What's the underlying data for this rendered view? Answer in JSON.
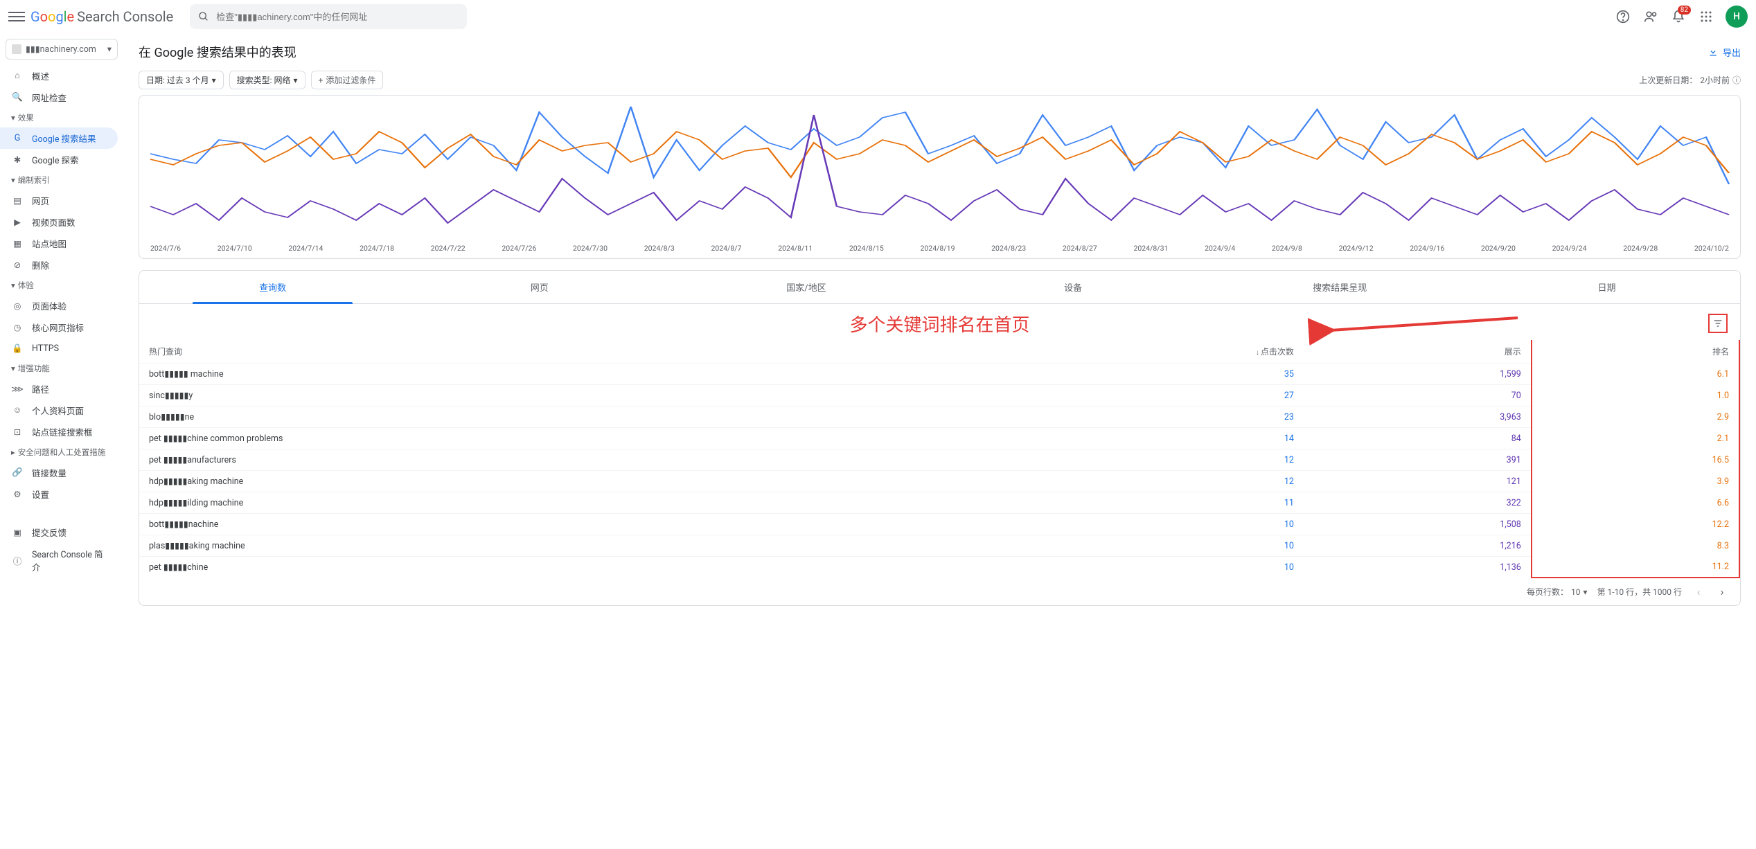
{
  "header": {
    "logo_text": "Search Console",
    "search_placeholder": "检查\"▮▮▮▮achinery.com\"中的任何网址",
    "notif_badge": "82",
    "avatar_letter": "H"
  },
  "property_name": "▮▮▮nachinery.com",
  "sidebar": {
    "overview": "概述",
    "url_inspect": "网址检查",
    "sec_performance": "效果",
    "google_search": "Google 搜索结果",
    "google_discover": "Google 探索",
    "sec_indexing": "编制索引",
    "pages": "网页",
    "video_pages": "视频页面数",
    "sitemaps": "站点地图",
    "removals": "删除",
    "sec_experience": "体验",
    "page_experience": "页面体验",
    "cwv": "核心网页指标",
    "https": "HTTPS",
    "sec_enhance": "增强功能",
    "breadcrumbs": "路径",
    "profile_pages": "个人资料页面",
    "sitelinks": "站点链接搜索框",
    "sec_security": "安全问题和人工处置措施",
    "links": "链接数量",
    "settings": "设置",
    "feedback": "提交反馈",
    "about": "Search Console 简介"
  },
  "page": {
    "title": "在 Google 搜索结果中的表现",
    "export": "导出",
    "date_chip": "日期: 过去 3 个月",
    "type_chip": "搜索类型: 网络",
    "add_filter": "添加过滤条件",
    "last_update_label": "上次更新日期：",
    "last_update_value": "2小时前"
  },
  "chart_data": {
    "type": "line",
    "x_labels": [
      "2024/7/6",
      "2024/7/10",
      "2024/7/14",
      "2024/7/18",
      "2024/7/22",
      "2024/7/26",
      "2024/7/30",
      "2024/8/3",
      "2024/8/7",
      "2024/8/11",
      "2024/8/15",
      "2024/8/19",
      "2024/8/23",
      "2024/8/27",
      "2024/8/31",
      "2024/9/4",
      "2024/9/8",
      "2024/9/12",
      "2024/9/16",
      "2024/9/20",
      "2024/9/24",
      "2024/9/28",
      "2024/10/2"
    ],
    "series": [
      {
        "name": "clicks",
        "color": "#4285f4",
        "values": [
          62,
          58,
          55,
          72,
          70,
          65,
          75,
          60,
          78,
          55,
          65,
          62,
          76,
          58,
          74,
          68,
          50,
          92,
          74,
          60,
          48,
          96,
          45,
          72,
          50,
          68,
          82,
          70,
          65,
          80,
          68,
          74,
          88,
          92,
          62,
          68,
          75,
          55,
          62,
          90,
          68,
          74,
          82,
          50,
          68,
          74,
          70,
          52,
          82,
          68,
          72,
          94,
          68,
          58,
          85,
          70,
          74,
          90,
          58,
          72,
          80,
          60,
          72,
          88,
          74,
          58,
          82,
          68,
          74,
          40
        ]
      },
      {
        "name": "impressions",
        "color": "#e8710a",
        "values": [
          58,
          54,
          62,
          68,
          70,
          56,
          64,
          74,
          58,
          62,
          78,
          70,
          52,
          66,
          76,
          60,
          54,
          72,
          64,
          68,
          70,
          56,
          62,
          78,
          72,
          58,
          64,
          66,
          45,
          70,
          58,
          62,
          72,
          68,
          56,
          64,
          72,
          60,
          66,
          74,
          58,
          64,
          72,
          54,
          62,
          78,
          70,
          56,
          60,
          72,
          64,
          58,
          74,
          68,
          54,
          62,
          76,
          70,
          58,
          64,
          72,
          56,
          62,
          78,
          70,
          54,
          62,
          74,
          68,
          48
        ]
      },
      {
        "name": "position",
        "color": "#673ab7",
        "values": [
          24,
          18,
          26,
          14,
          30,
          20,
          16,
          28,
          22,
          14,
          26,
          18,
          30,
          12,
          24,
          36,
          28,
          20,
          44,
          30,
          18,
          26,
          34,
          14,
          28,
          22,
          38,
          30,
          16,
          90,
          24,
          20,
          18,
          32,
          26,
          14,
          28,
          36,
          22,
          18,
          44,
          26,
          14,
          30,
          24,
          18,
          32,
          20,
          26,
          14,
          28,
          22,
          18,
          34,
          26,
          14,
          30,
          24,
          18,
          32,
          20,
          26,
          14,
          28,
          36,
          22,
          18,
          30,
          24,
          18
        ]
      }
    ]
  },
  "tabs": [
    "查询数",
    "网页",
    "国家/地区",
    "设备",
    "搜索结果呈现",
    "日期"
  ],
  "annotation": "多个关键词排名在首页",
  "table": {
    "header_query": "热门查询",
    "header_clicks": "点击次数",
    "header_impr": "展示",
    "header_pos": "排名",
    "rows": [
      {
        "q": "bott▮▮▮▮▮ machine",
        "clicks": "35",
        "impr": "1,599",
        "pos": "6.1"
      },
      {
        "q": "sinc▮▮▮▮▮y",
        "clicks": "27",
        "impr": "70",
        "pos": "1.0"
      },
      {
        "q": "blo▮▮▮▮▮ne",
        "clicks": "23",
        "impr": "3,963",
        "pos": "2.9"
      },
      {
        "q": "pet ▮▮▮▮▮chine common problems",
        "clicks": "14",
        "impr": "84",
        "pos": "2.1"
      },
      {
        "q": "pet ▮▮▮▮▮anufacturers",
        "clicks": "12",
        "impr": "391",
        "pos": "16.5"
      },
      {
        "q": "hdp▮▮▮▮▮aking machine",
        "clicks": "12",
        "impr": "121",
        "pos": "3.9"
      },
      {
        "q": "hdp▮▮▮▮▮ilding machine",
        "clicks": "11",
        "impr": "322",
        "pos": "6.6"
      },
      {
        "q": "bott▮▮▮▮▮nachine",
        "clicks": "10",
        "impr": "1,508",
        "pos": "12.2"
      },
      {
        "q": "plas▮▮▮▮▮aking machine",
        "clicks": "10",
        "impr": "1,216",
        "pos": "8.3"
      },
      {
        "q": "pet ▮▮▮▮▮chine",
        "clicks": "10",
        "impr": "1,136",
        "pos": "11.2"
      }
    ]
  },
  "pagination": {
    "rows_label": "每页行数：",
    "rows_value": "10",
    "range": "第 1-10 行，共 1000 行"
  }
}
